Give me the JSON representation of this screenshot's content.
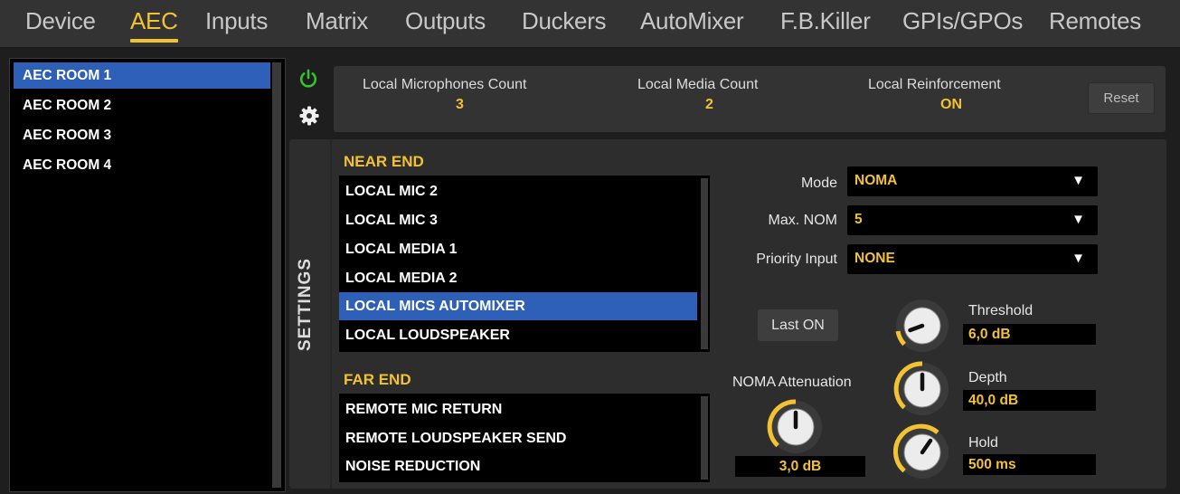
{
  "nav": {
    "tabs": [
      "Device",
      "AEC",
      "Inputs",
      "Matrix",
      "Outputs",
      "Duckers",
      "AutoMixer",
      "F.B.Killer",
      "GPIs/GPOs",
      "Remotes"
    ],
    "active": "AEC"
  },
  "rooms": [
    "AEC ROOM 1",
    "AEC ROOM 2",
    "AEC ROOM 3",
    "AEC ROOM 4"
  ],
  "selected_room": "AEC ROOM 1",
  "header": {
    "mic_count_label": "Local Microphones Count",
    "mic_count_value": "3",
    "media_count_label": "Local Media Count",
    "media_count_value": "2",
    "reinforcement_label": "Local Reinforcement",
    "reinforcement_value": "ON",
    "reset_label": "Reset",
    "icons": [
      "power-icon",
      "gear-icon"
    ]
  },
  "settings": {
    "side_label": "SETTINGS",
    "near_end_title": "NEAR END",
    "near_end_items": [
      "LOCAL MIC 2",
      "LOCAL MIC 3",
      "LOCAL MEDIA 1",
      "LOCAL MEDIA 2",
      "LOCAL MICS AUTOMIXER",
      "LOCAL LOUDSPEAKER"
    ],
    "near_end_selected": "LOCAL MICS AUTOMIXER",
    "far_end_title": "FAR END",
    "far_end_items": [
      "REMOTE MIC RETURN",
      "REMOTE LOUDSPEAKER SEND",
      "NOISE REDUCTION"
    ],
    "mode_label": "Mode",
    "mode_value": "NOMA",
    "maxnom_label": "Max. NOM",
    "maxnom_value": "5",
    "priority_label": "Priority Input",
    "priority_value": "NONE",
    "lastton_label": "Last ON",
    "noma_att_label": "NOMA Attenuation",
    "noma_att_value": "3,0 dB",
    "threshold_label": "Threshold",
    "threshold_value": "6,0 dB",
    "depth_label": "Depth",
    "depth_value": "40,0 dB",
    "hold_label": "Hold",
    "hold_value": "500 ms"
  },
  "colors": {
    "accent": "#f2c232",
    "selection": "#2f60b8",
    "power_green": "#31c42c",
    "panel": "#333333"
  }
}
